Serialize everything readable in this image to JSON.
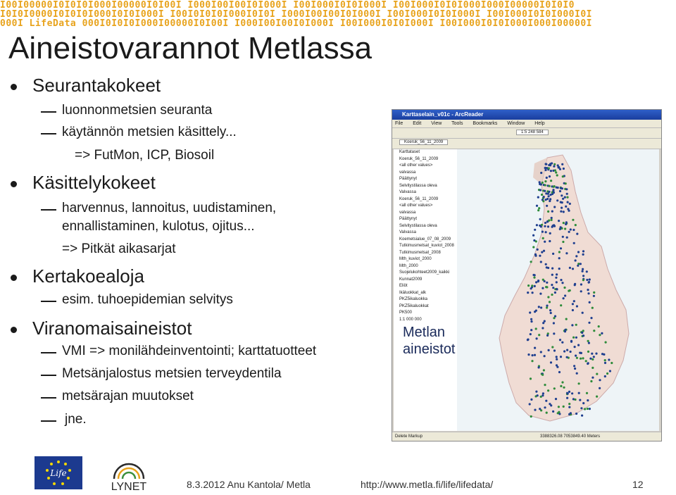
{
  "banner": {
    "row1": "I00I00000I0I0I0I000I00000I0I00I I000I00I00I0I000I I00I000I0I0I000I I00I000I0I0I000I000I00000I0I0I0",
    "row2": "I0I0I0000I0I0I0I000I0I0I000I I00I0I0I0I000I0I0I I000I00I00I0I000I I00I000I0I0I000I I00I000I0I0I000I0I",
    "row3": "000I LifeData 000I0I0I0I000I00000I0I00I I000I00I00I0I000I I00I000I0I0I000I I00I000I0I0I000I000I00000I",
    "logo": "LifeData"
  },
  "title": "Aineistovarannot Metlassa",
  "sections": [
    {
      "label": "Seurantakokeet",
      "items": [
        "luonnonmetsien seuranta",
        "käytännön metsien käsittely..."
      ],
      "note": "=> FutMon, ICP, Biosoil"
    },
    {
      "label": "Käsittelykokeet",
      "items": [
        "harvennus, lannoitus, uudistaminen,",
        "ennallistaminen, kulotus, ojitus..."
      ],
      "note": "=> Pitkät aikasarjat"
    },
    {
      "label": "Kertakoealoja",
      "items": [
        "esim. tuhoepidemian selvitys"
      ]
    },
    {
      "label": "Viranomaisaineistot",
      "items": [
        "VMI => monilähdeinventointi; karttatuotteet",
        "Metsänjalostus metsien terveydentila",
        "metsärajan muutokset",
        "jne."
      ]
    }
  ],
  "app": {
    "title": "Karttaselain_v01c - ArcReader",
    "menu": [
      "File",
      "Edit",
      "View",
      "Tools",
      "Bookmarks",
      "Window",
      "Help"
    ],
    "scale": "1:5 248 584",
    "layer_select": "Koeruk_56_11_2009",
    "toc": [
      "Karttataset",
      "Koeruk_56_11_2009",
      "<all other values>",
      "valvassa",
      "Päättynyt",
      "Selvitystilassa oleva",
      "Valvassa",
      "Koeruk_56_11_2009",
      "<all other values>",
      "valvassa",
      "Päättynyt",
      "Selvitystilassa oleva",
      "Valvassa",
      "Koemetsialue_07_08_2009",
      "Tutkimusmetsat_kuviot_2008",
      "Tutkimusmetsat_2008",
      "Mth_kuviot_2000",
      "Mth_2000",
      "Suojelukohteet2009_kaikki",
      "Kunnat2009",
      "Eliöt",
      "Ikäluokkat_alk",
      "PKZ5ikaluokka",
      "PKZ5ikaluokkat",
      "PK500",
      "1:1 000 000"
    ],
    "status_left": "Delete Markup",
    "status_right": "3388326.08 7053849.40 Meters"
  },
  "overlay": {
    "line1": "Metlan",
    "line2": "aineistot"
  },
  "footer": {
    "date_author": "8.3.2012 Anu Kantola/ Metla",
    "url": "http://www.metla.fi/life/lifedata/",
    "page": "12",
    "lynet": "LYNET",
    "life": "Life"
  },
  "colors": {
    "banner": "#e8a31c",
    "eu_blue": "#1c3a8f",
    "app_title": "#2f5fc9"
  }
}
